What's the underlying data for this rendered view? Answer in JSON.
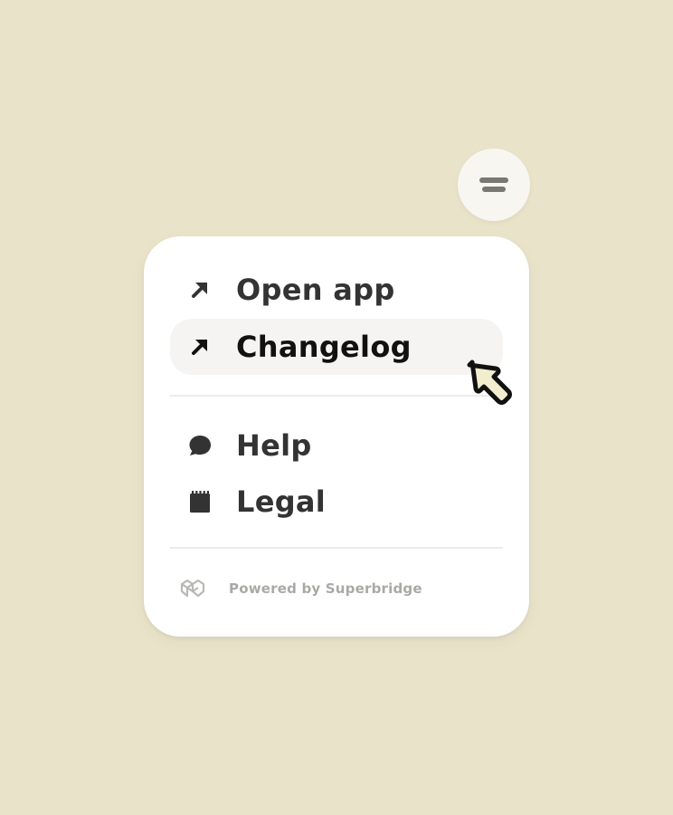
{
  "menu_button": {
    "icon": "menu-icon"
  },
  "menu": {
    "items": [
      {
        "label": "Open app",
        "icon": "arrow-up-right-icon",
        "hovered": false
      },
      {
        "label": "Changelog",
        "icon": "arrow-up-right-icon",
        "hovered": true
      },
      {
        "label": "Help",
        "icon": "chat-bubble-icon",
        "hovered": false
      },
      {
        "label": "Legal",
        "icon": "notepad-icon",
        "hovered": false
      }
    ],
    "footer": {
      "text": "Powered by Superbridge",
      "logo": "superbridge-logo-icon"
    }
  },
  "colors": {
    "background": "#e9e3c9",
    "panel": "#ffffff",
    "hover": "#f5f4f2",
    "text": "#333333",
    "muted": "#a9a9a6",
    "cursor_fill": "#f3edcf"
  }
}
